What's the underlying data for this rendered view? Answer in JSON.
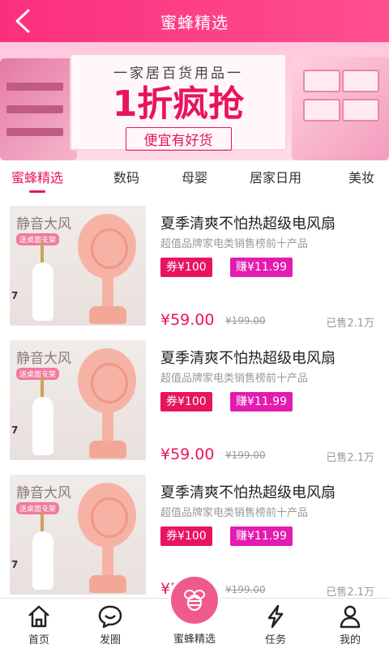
{
  "header": {
    "title": "蜜蜂精选"
  },
  "banner": {
    "subtitle": "一家居百货用品一",
    "headline": "1折疯抢",
    "slogan": "便宜有好货"
  },
  "tabs": [
    {
      "label": "蜜蜂精选",
      "active": true
    },
    {
      "label": "数码",
      "active": false
    },
    {
      "label": "母婴",
      "active": false
    },
    {
      "label": "居家日用",
      "active": false
    },
    {
      "label": "美妆",
      "active": false
    }
  ],
  "products": [
    {
      "image_text": "静音大风",
      "image_tag": "送桌面支架",
      "image_num": "7",
      "name": "夏季清爽不怕热超级电风扇",
      "desc": "超值品牌家电类销售榜前十产品",
      "coupon": "券¥100",
      "earn": "赚¥11.99",
      "price": "¥59.00",
      "original": "¥199.00",
      "sold": "已售2.1万"
    },
    {
      "image_text": "静音大风",
      "image_tag": "送桌面支架",
      "image_num": "7",
      "name": "夏季清爽不怕热超级电风扇",
      "desc": "超值品牌家电类销售榜前十产品",
      "coupon": "券¥100",
      "earn": "赚¥11.99",
      "price": "¥59.00",
      "original": "¥199.00",
      "sold": "已售2.1万"
    },
    {
      "image_text": "静音大风",
      "image_tag": "送桌面支架",
      "image_num": "7",
      "name": "夏季清爽不怕热超级电风扇",
      "desc": "超值品牌家电类销售榜前十产品",
      "coupon": "券¥100",
      "earn": "赚¥11.99",
      "price": "¥59.00",
      "original": "¥199.00",
      "sold": "已售2.1万"
    }
  ],
  "tabbar": {
    "home": "首页",
    "post": "发圈",
    "featured": "蜜蜂精选",
    "tasks": "任务",
    "mine": "我的"
  },
  "icons": {
    "home": "home-icon",
    "post": "chat-bubble-icon",
    "featured": "bee-icon",
    "tasks": "lightning-icon",
    "mine": "user-icon",
    "back": "chevron-left-icon"
  },
  "colors": {
    "brand": "#e8145f",
    "header": "#fb2f7d",
    "earn": "#e41bb0"
  }
}
